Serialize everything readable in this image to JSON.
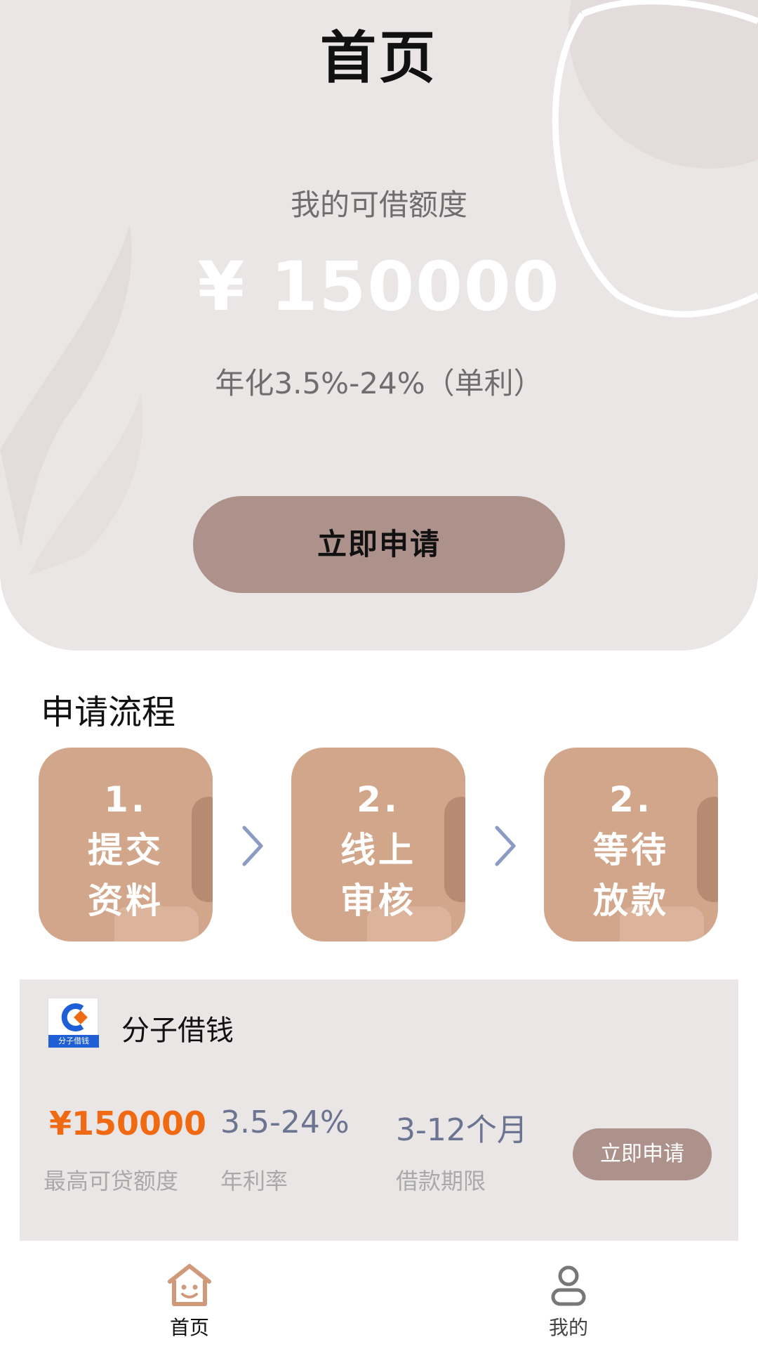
{
  "header": {
    "title": "首页"
  },
  "hero": {
    "quota_label": "我的可借额度",
    "quota_amount": "¥ 150000",
    "rate_text": "年化3.5%-24%（单利）",
    "apply_label": "立即申请"
  },
  "process": {
    "title": "申请流程",
    "steps": [
      {
        "text": "1.\n提交\n资料"
      },
      {
        "text": "2.\n线上\n审核"
      },
      {
        "text": "2.\n等待\n放款"
      }
    ]
  },
  "product": {
    "logo_caption": "分子借钱",
    "name": "分子借钱",
    "amount": "¥150000",
    "amount_label": "最高可贷额度",
    "rate": "3.5-24%",
    "rate_label": "年利率",
    "term": "3-12个月",
    "term_label": "借款期限",
    "apply_label": "立即申请"
  },
  "nav": {
    "items": [
      {
        "label": "首页",
        "icon": "home-smile-icon",
        "active": true
      },
      {
        "label": "我的",
        "icon": "user-icon",
        "active": false
      }
    ]
  },
  "colors": {
    "hero_bg": "#ebe6e6",
    "button": "#ad928b",
    "step": "#d2a68b",
    "accent_orange": "#f06a14",
    "stat_blue_gray": "#6b7591"
  }
}
